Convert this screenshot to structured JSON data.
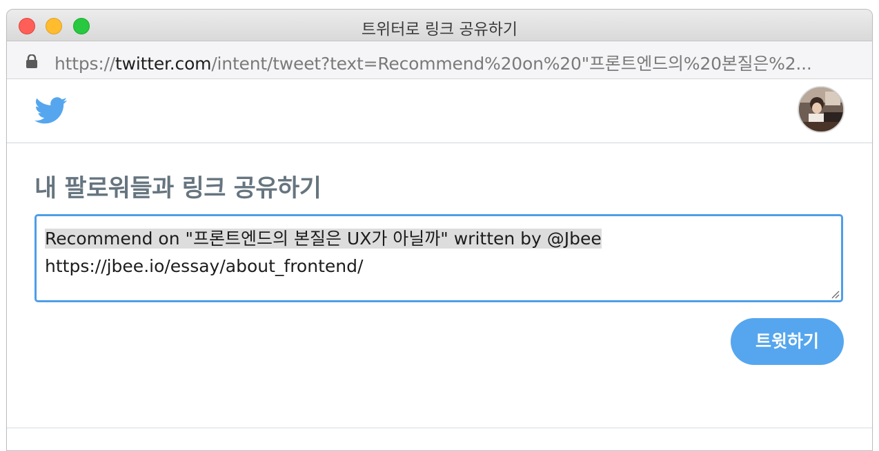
{
  "window": {
    "title": "트위터로 링크 공유하기"
  },
  "address_bar": {
    "url_prefix": "https://",
    "url_host": "twitter.com",
    "url_path": "/intent/tweet?text=Recommend%20on%20\"프론트엔드의%20본질은%2..."
  },
  "page": {
    "heading": "내 팔로워들과 링크 공유하기",
    "tweet_text_line1": "Recommend on \"프론트엔드의 본질은 UX가 아닐까\" written by @Jbee",
    "tweet_text_line2": "https://jbee.io/essay/about_frontend/",
    "tweet_button_label": "트윗하기"
  },
  "colors": {
    "twitter_blue": "#55a6ee",
    "heading_gray": "#66757f",
    "focus_border": "#4d9ee8"
  },
  "icons": {
    "logo": "twitter-bird-icon",
    "lock": "lock-icon",
    "avatar": "user-avatar"
  }
}
